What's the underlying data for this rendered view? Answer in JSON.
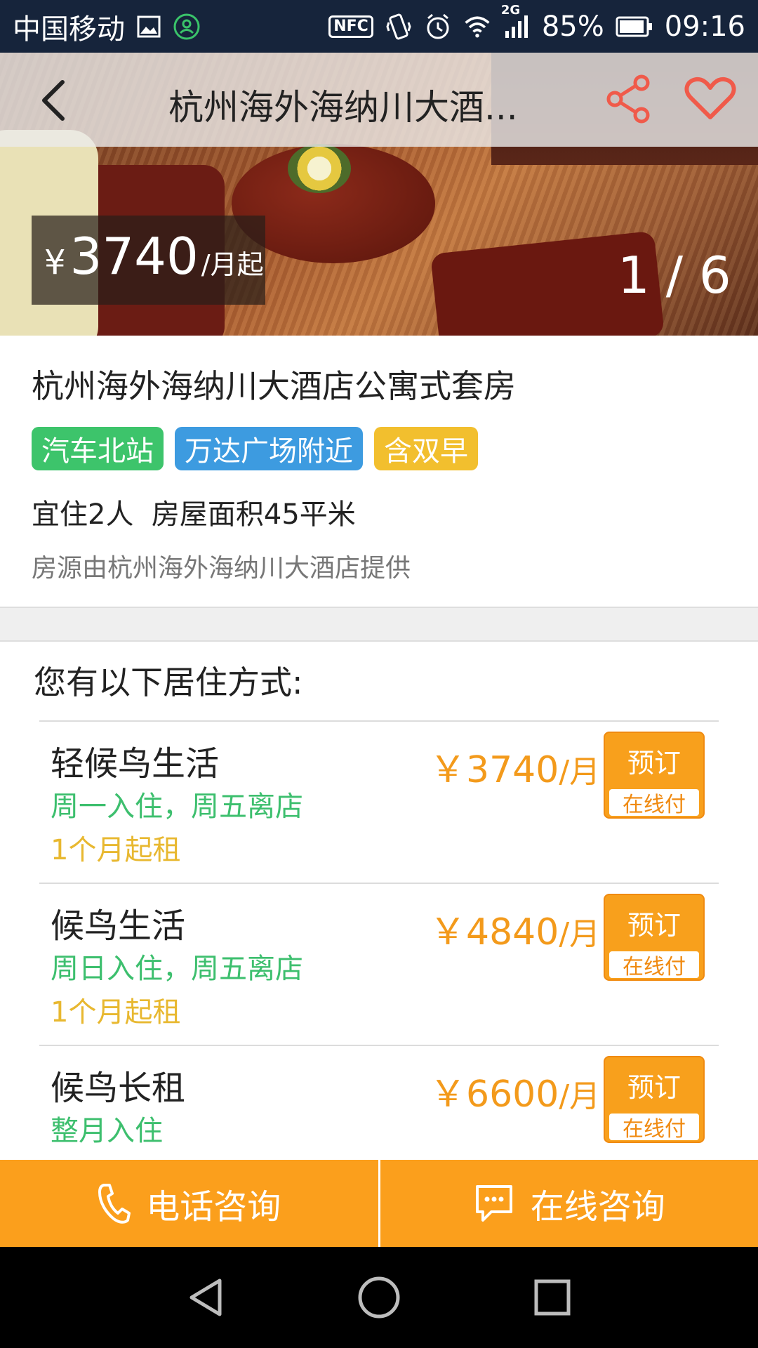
{
  "status_bar": {
    "carrier": "中国移动",
    "battery": "85%",
    "time": "09:16",
    "network": "2G"
  },
  "nav": {
    "title": "杭州海外海纳川大酒...",
    "back_icon": "back-chevron-icon",
    "share_icon": "share-icon",
    "favorite_icon": "heart-icon"
  },
  "hero": {
    "price_currency": "¥",
    "price_value": "3740",
    "price_unit": "/月起",
    "photo_counter": "1 / 6"
  },
  "listing": {
    "title": "杭州海外海纳川大酒店公寓式套房",
    "tags": [
      {
        "label": "汽车北站",
        "color": "#3dc46b"
      },
      {
        "label": "万达广场附近",
        "color": "#3d9be0"
      },
      {
        "label": "含双早",
        "color": "#f2bf2e"
      }
    ],
    "spec": "宜住2人  房屋面积45平米",
    "provider": "房源由杭州海外海纳川大酒店提供"
  },
  "options": {
    "heading": "您有以下居住方式:",
    "items": [
      {
        "name": "轻候鸟生活",
        "schedule": "周一入住，周五离店",
        "min_term": "1个月起租",
        "price": "￥3740",
        "unit": "/月",
        "book_label": "预订",
        "pay_label": "在线付"
      },
      {
        "name": "候鸟生活",
        "schedule": "周日入住，周五离店",
        "min_term": "1个月起租",
        "price": "￥4840",
        "unit": "/月",
        "book_label": "预订",
        "pay_label": "在线付"
      },
      {
        "name": "候鸟长租",
        "schedule": "整月入住",
        "min_term": "",
        "price": "￥6600",
        "unit": "/月",
        "book_label": "预订",
        "pay_label": "在线付"
      }
    ]
  },
  "bottom_bar": {
    "phone_label": "电话咨询",
    "online_label": "在线咨询"
  },
  "colors": {
    "accent_orange": "#fb9f1c",
    "price_orange": "#f39a1b",
    "green": "#3dbf6e",
    "yellow": "#e8b830",
    "icon_red": "#f05a4a"
  }
}
